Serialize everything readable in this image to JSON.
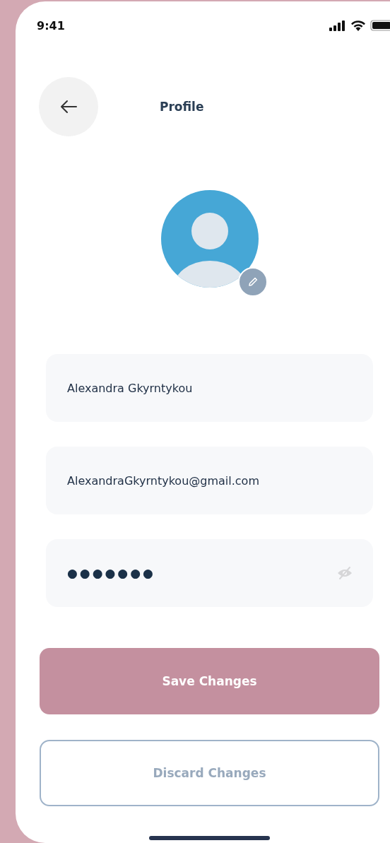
{
  "status_bar": {
    "time": "9:41"
  },
  "header": {
    "title": "Profile"
  },
  "fields": [
    {
      "kind": "text",
      "value": "Alexandra Gkyrntykou"
    },
    {
      "kind": "text",
      "value": "AlexandraGkyrntykou@gmail.com"
    },
    {
      "kind": "password",
      "value": "●●●●●●●",
      "masked": true
    }
  ],
  "buttons": [
    {
      "label": "Save Changes",
      "kind": "primary",
      "disabled": true
    },
    {
      "label": "Discard Changes",
      "kind": "outline",
      "disabled": false
    }
  ]
}
